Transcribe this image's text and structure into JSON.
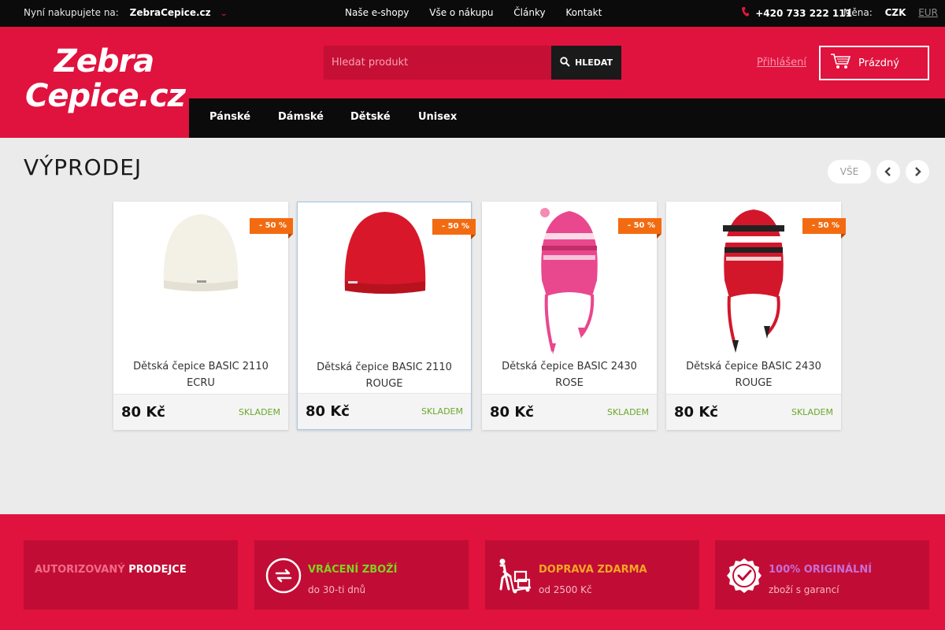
{
  "topbar": {
    "shop_label": "Nyní nakupujete na:",
    "shop_value": "ZebraCepice.cz",
    "nav": [
      "Naše e-shopy",
      "Vše o nákupu",
      "Články",
      "Kontakt"
    ],
    "phone": "+420 733 222 111",
    "currency_label": "Měna:",
    "currency_active": "CZK",
    "currency_other": "EUR"
  },
  "header": {
    "logo_line1": "Zebra",
    "logo_line2": "Cepice.cz",
    "search_placeholder": "Hledat produkt",
    "search_button": "HLEDAT",
    "login": "Přihlášení",
    "cart": "Prázdný"
  },
  "mainnav": [
    "Pánské",
    "Dámské",
    "Dětské",
    "Unisex"
  ],
  "sale": {
    "title": "VÝPRODEJ",
    "all_label": "VŠE"
  },
  "products": [
    {
      "name": "Dětská čepice BASIC 2110 ECRU",
      "price": "80 Kč",
      "stock": "SKLADEM",
      "discount": "- 50 %"
    },
    {
      "name": "Dětská čepice BASIC 2110 ROUGE",
      "price": "80 Kč",
      "stock": "SKLADEM",
      "discount": "- 50 %"
    },
    {
      "name": "Dětská čepice BASIC 2430 ROSE",
      "price": "80 Kč",
      "stock": "SKLADEM",
      "discount": "- 50 %"
    },
    {
      "name": "Dětská čepice BASIC 2430 ROUGE",
      "price": "80 Kč",
      "stock": "SKLADEM",
      "discount": "- 50 %"
    }
  ],
  "features": [
    {
      "t1a": "AUTORIZOVANÝ",
      "t1b": "PRODEJCE",
      "t2": "",
      "color": "#f36b8a"
    },
    {
      "t1a": "VRÁCENÍ ZBOŽÍ",
      "t1b": "",
      "t2": "do 30-ti dnů",
      "color": "#7ed321"
    },
    {
      "t1a": "DOPRAVA ZDARMA",
      "t1b": "",
      "t2": "od 2500 Kč",
      "color": "#f5a623"
    },
    {
      "t1a": "100% ORIGINÁLNÍ",
      "t1b": "",
      "t2": "zboží s garancí",
      "color": "#c86dd7"
    }
  ],
  "colors": {
    "brand_red": "#e0123e",
    "discount_orange": "#f36b10",
    "stock_green": "#6aa82b"
  }
}
